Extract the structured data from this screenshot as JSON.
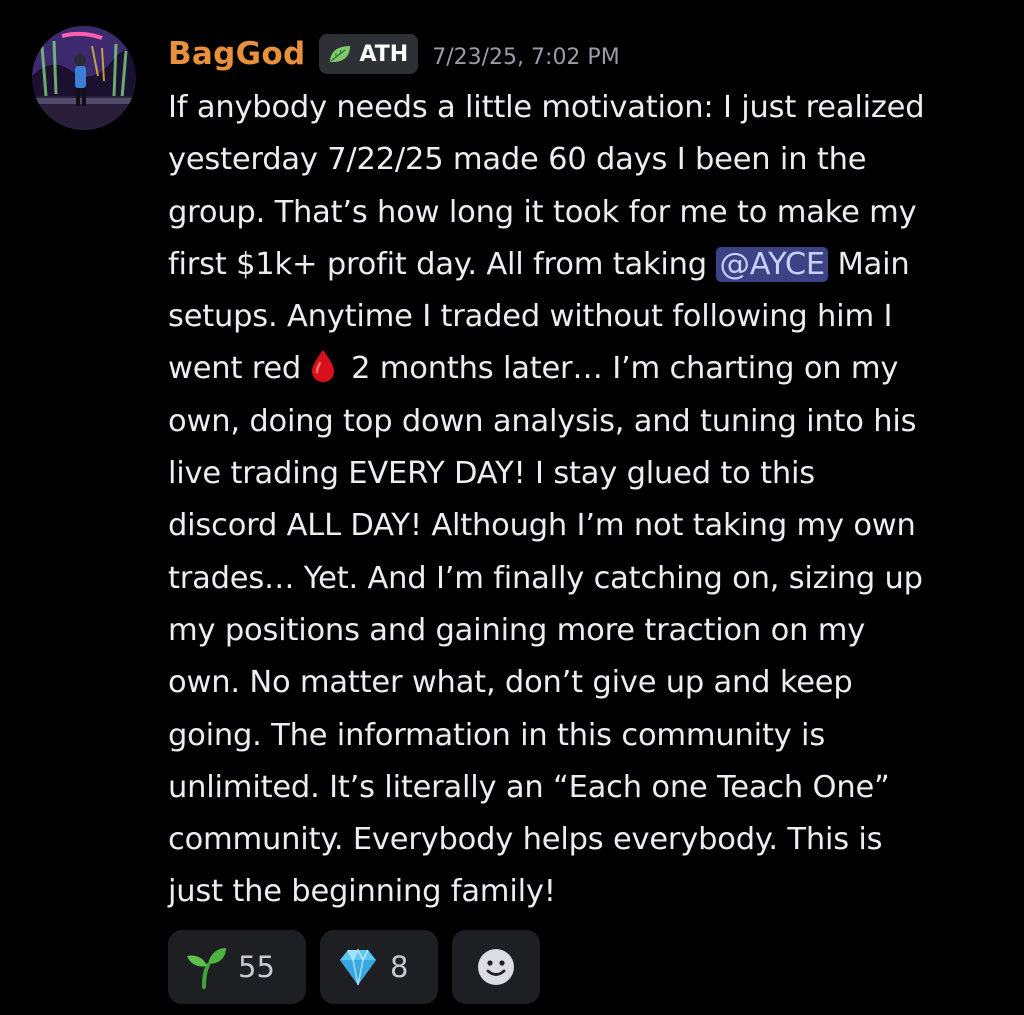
{
  "message": {
    "author": "BagGod",
    "tag": {
      "label": "ATH",
      "icon": "leaf-icon"
    },
    "timestamp": "7/23/25, 7:02 PM",
    "lines": [
      "If anybody needs a little motivation: I just realized",
      "yesterday 7/22/25 made 60 days I been in the",
      "group. That’s how long it took for me to make my",
      {
        "before": "first $1k+ profit day. All from taking ",
        "mention": "@AYCE",
        "after": " Main"
      },
      "setups. Anytime I traded without following him I",
      {
        "before": "went red",
        "emoji": "drop-of-blood-icon",
        "after": "2 months later… I’m charting on my"
      },
      "own, doing top down analysis, and tuning into his",
      "live trading EVERY DAY! I stay glued to this",
      "discord ALL DAY! Although I’m not taking my own",
      "trades… Yet. And I’m finally catching on, sizing up",
      "my positions and gaining more traction on my",
      "own. No matter what, don’t give up and keep",
      "going. The information in this community is",
      "unlimited. It’s literally an “Each one Teach One”",
      "community. Everybody helps everybody. This is",
      "just the beginning family!"
    ]
  },
  "reactions": [
    {
      "emoji": "seedling-icon",
      "count": "55"
    },
    {
      "emoji": "gem-icon",
      "count": "8"
    },
    {
      "emoji": "add-reaction-icon",
      "count": ""
    }
  ],
  "colors": {
    "background": "#000000",
    "author": "#e8903a",
    "text": "#ededf0",
    "timestamp": "#9c9ca4",
    "mention_bg": "#3c4385",
    "reaction_bg": "#1e1f23"
  }
}
